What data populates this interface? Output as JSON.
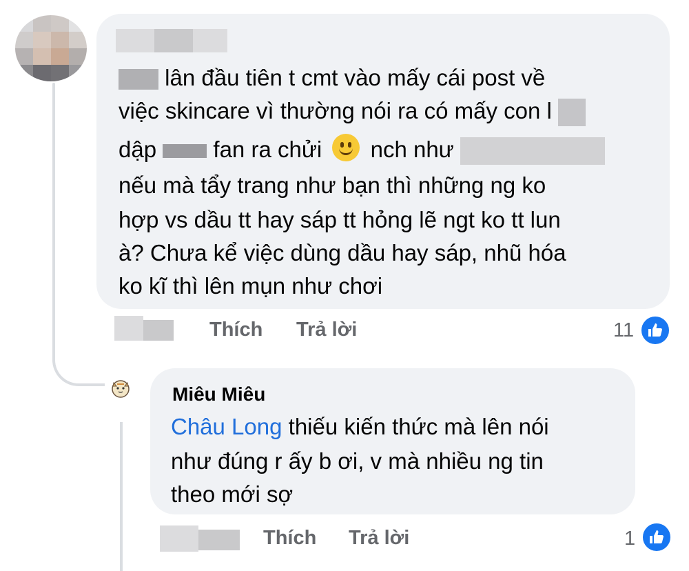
{
  "comment1": {
    "lines": [
      "lân đầu tiên t cmt vào mấy cái post về",
      "việc skincare vì thường nói ra có mấy con l",
      "dập",
      "fan ra chửi",
      "nch như",
      "nếu mà tẩy trang như bạn thì những ng ko",
      "hợp vs dầu tt hay sáp tt hỏng lẽ ngt ko tt lun",
      "à? Chưa kể việc dùng dầu hay sáp, nhũ hóa",
      "ko kĩ thì lên mụn như chơi"
    ],
    "actions": {
      "like": "Thích",
      "reply": "Trả lời"
    },
    "reaction_count": "11",
    "reaction_icon": "thumbs-up-icon"
  },
  "comment2": {
    "author": "Miêu Miêu",
    "mention": "Châu Long",
    "text_line1": " thiếu kiến thức mà lên nói",
    "text_line2": "như đúng r ấy b ơi, v mà nhiều ng tin",
    "text_line3": "theo mới sợ",
    "actions": {
      "like": "Thích",
      "reply": "Trả lời"
    },
    "reaction_count": "1",
    "reaction_icon": "thumbs-up-icon"
  },
  "colors": {
    "bubble": "#f0f2f5",
    "mention": "#216fdb",
    "meta": "#65676b",
    "like_badge": "#1877f2"
  }
}
